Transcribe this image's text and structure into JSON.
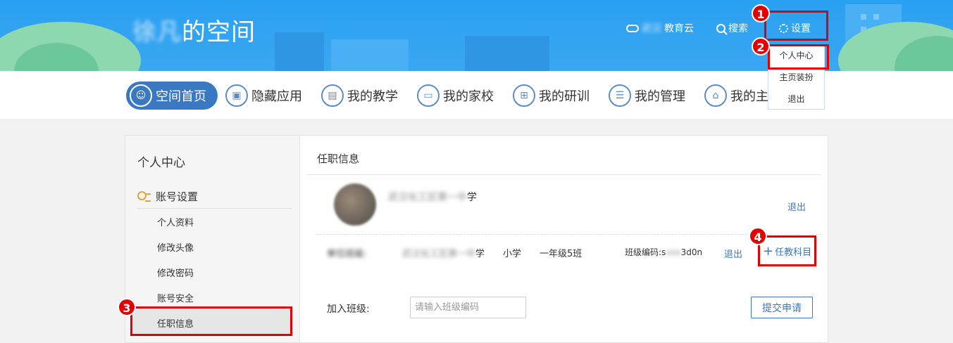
{
  "header": {
    "title_blurred": "徐凡",
    "title_suffix": "的空间",
    "cloud_blurred": "武汉",
    "cloud_suffix": "教育云",
    "search_label": "搜索",
    "settings_label": "设置"
  },
  "settings_menu": {
    "items": [
      {
        "label": "个人中心"
      },
      {
        "label": "主页装扮"
      },
      {
        "label": "退出"
      }
    ]
  },
  "nav": {
    "items": [
      {
        "label": "空间首页",
        "icon": "user-icon"
      },
      {
        "label": "隐藏应用",
        "icon": "app-icon"
      },
      {
        "label": "我的教学",
        "icon": "book-icon"
      },
      {
        "label": "我的家校",
        "icon": "laptop-icon"
      },
      {
        "label": "我的研训",
        "icon": "grid-icon"
      },
      {
        "label": "我的管理",
        "icon": "doc-icon"
      },
      {
        "label": "我的主",
        "icon": "home-icon"
      }
    ]
  },
  "sidebar": {
    "title": "个人中心",
    "group_label": "账号设置",
    "items": [
      {
        "label": "个人资料"
      },
      {
        "label": "修改头像"
      },
      {
        "label": "修改密码"
      },
      {
        "label": "账号安全"
      },
      {
        "label": "任职信息"
      }
    ]
  },
  "main": {
    "title": "任职信息",
    "school_blurred": "武汉化工区第一中",
    "school_suffix": "学",
    "quit_label": "退出",
    "row": {
      "label_blurred": "单位班级:",
      "school_blurred": "武汉化工区第一中",
      "school_suffix": "学",
      "stage": "小学",
      "grade_class": "一年级5班",
      "code_prefix": "班级编码:s",
      "code_blurred": "xxx",
      "code_suffix": "3d0n",
      "quit_label": "退出",
      "add_subject_label": "任教科目"
    },
    "join_label": "加入班级:",
    "join_placeholder": "请输入班级编码",
    "submit_label": "提交申请"
  },
  "annotations": {
    "markers": [
      "1",
      "2",
      "3",
      "4"
    ],
    "color": "#e30000"
  }
}
